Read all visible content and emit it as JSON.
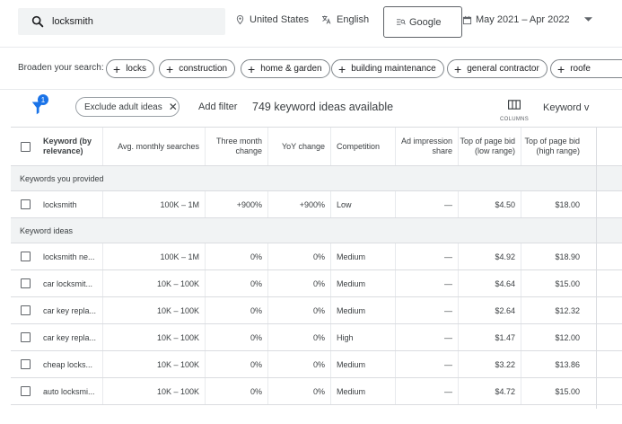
{
  "search": {
    "query": "locksmith"
  },
  "location": "United States",
  "language": "English",
  "engine": "Google",
  "date_range": "May 2021 – Apr 2022",
  "broaden": {
    "label": "Broaden your search:",
    "chips": [
      "locks",
      "construction",
      "home & garden",
      "building maintenance",
      "general contractor",
      "roofe"
    ]
  },
  "filters": {
    "badge_count": "1",
    "exclude_label": "Exclude adult ideas",
    "add_filter": "Add filter",
    "available": "749 keyword ideas available",
    "columns_label": "COLUMNS",
    "keyword_view": "Keyword v"
  },
  "table": {
    "headers": {
      "keyword": "Keyword (by relevance)",
      "avg": "Avg. monthly searches",
      "three_month": "Three month change",
      "yoy": "YoY change",
      "competition": "Competition",
      "ad_impression": "Ad impression share",
      "bid_low": "Top of page bid (low range)",
      "bid_high": "Top of page bid (high range)"
    },
    "section_provided": "Keywords you provided",
    "section_ideas": "Keyword ideas",
    "provided_rows": [
      {
        "keyword": "locksmith",
        "avg": "100K – 1M",
        "three": "+900%",
        "yoy": "+900%",
        "comp": "Low",
        "ad": "—",
        "low": "$4.50",
        "high": "$18.00"
      }
    ],
    "idea_rows": [
      {
        "keyword": "locksmith ne...",
        "avg": "100K – 1M",
        "three": "0%",
        "yoy": "0%",
        "comp": "Medium",
        "ad": "—",
        "low": "$4.92",
        "high": "$18.90"
      },
      {
        "keyword": "car locksmit...",
        "avg": "10K – 100K",
        "three": "0%",
        "yoy": "0%",
        "comp": "Medium",
        "ad": "—",
        "low": "$4.64",
        "high": "$15.00"
      },
      {
        "keyword": "car key repla...",
        "avg": "10K – 100K",
        "three": "0%",
        "yoy": "0%",
        "comp": "Medium",
        "ad": "—",
        "low": "$2.64",
        "high": "$12.32"
      },
      {
        "keyword": "car key repla...",
        "avg": "10K – 100K",
        "three": "0%",
        "yoy": "0%",
        "comp": "High",
        "ad": "—",
        "low": "$1.47",
        "high": "$12.00"
      },
      {
        "keyword": "cheap locks...",
        "avg": "10K – 100K",
        "three": "0%",
        "yoy": "0%",
        "comp": "Medium",
        "ad": "—",
        "low": "$3.22",
        "high": "$13.86"
      },
      {
        "keyword": "auto locksmi...",
        "avg": "10K – 100K",
        "three": "0%",
        "yoy": "0%",
        "comp": "Medium",
        "ad": "—",
        "low": "$4.72",
        "high": "$15.00"
      }
    ]
  },
  "colors": {
    "accent": "#1a73e8",
    "section_bg": "#f1f3f4",
    "border": "#dadce0"
  }
}
